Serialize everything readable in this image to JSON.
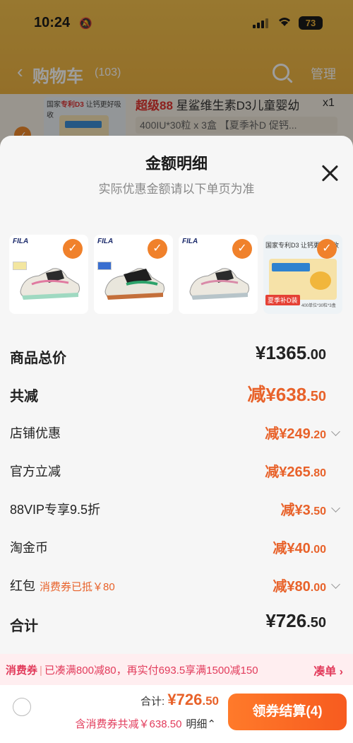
{
  "status_bar": {
    "time": "10:24",
    "battery": "73"
  },
  "cart_header": {
    "title": "购物车",
    "count": "(103)",
    "manage": "管理"
  },
  "bg_item": {
    "thumb_text_a": "国家",
    "thumb_text_b": "专利D3",
    "thumb_text_c": "让钙更好吸收",
    "name_highlight": "超级88",
    "name_rest": "星鲨维生素D3儿童婴幼",
    "spec": "400IU*30粒 x 3盒 【夏季补D 促钙...",
    "qty": "x1"
  },
  "sheet": {
    "title": "金额明细",
    "subtitle": "实际优惠金额请以下单页为准"
  },
  "products": [
    {
      "brand": "FILA",
      "checked": true
    },
    {
      "brand": "FILA",
      "checked": true
    },
    {
      "brand": "FILA",
      "checked": true
    },
    {
      "brand": "国家专利D3 让钙更好吸收",
      "badge": "夏季补D装",
      "small": "400单位*30粒*3盒",
      "checked": true
    }
  ],
  "rows": {
    "total_price": {
      "label": "商品总价",
      "currency": "¥",
      "int": "1365",
      "dec": ".00"
    },
    "total_discount": {
      "label": "共减",
      "prefix": "减¥",
      "int": "638",
      "dec": ".50"
    },
    "shop_discount": {
      "label": "店铺优惠",
      "prefix": "减¥",
      "int": "249",
      "dec": ".20"
    },
    "official_discount": {
      "label": "官方立减",
      "prefix": "减¥",
      "int": "265",
      "dec": ".80"
    },
    "vip_discount": {
      "label": "88VIP专享9.5折",
      "prefix": "减¥",
      "int": "3",
      "dec": ".50"
    },
    "taojinbi": {
      "label": "淘金币",
      "prefix": "减¥",
      "int": "40",
      "dec": ".00"
    },
    "red_packet": {
      "label": "红包",
      "sub": "消费券已抵￥80",
      "prefix": "减¥",
      "int": "80",
      "dec": ".00"
    },
    "sum": {
      "label": "合计",
      "currency": "¥",
      "int": "726",
      "dec": ".50"
    }
  },
  "coupon_bar": {
    "tag": "消费券",
    "text": "已凑满800减80，再实付693.5享满1500减150",
    "action": "凑单 ›"
  },
  "bottom_bar": {
    "total_label": "合计:",
    "total_currency": "¥",
    "total_int": "726",
    "total_dec": ".50",
    "discount_text": "含消费券共减￥638.50",
    "detail_label": "明细⌃",
    "checkout_label": "领券结算(4)"
  },
  "colors": {
    "accent": "#e8622a",
    "coupon": "#e23b5b",
    "header_bg": "#f2b53a"
  }
}
